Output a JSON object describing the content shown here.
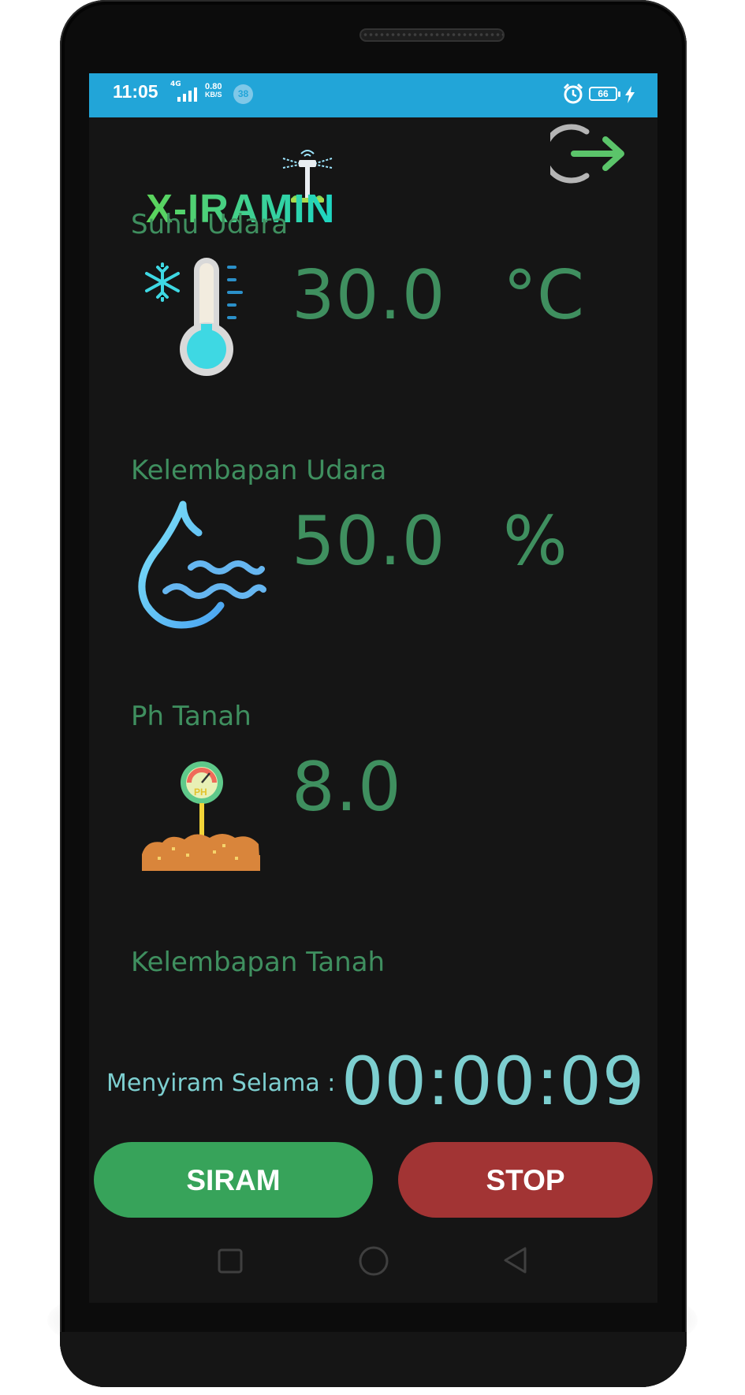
{
  "status_bar": {
    "time": "11:05",
    "network_type": "4G",
    "speed_value": "0.80",
    "speed_unit": "KB/S",
    "notification_count": "38",
    "battery": "66"
  },
  "header": {
    "logo_text": "X-IRAMIN",
    "logout_icon": "logout-arrow-icon"
  },
  "cards": [
    {
      "title": "Suhu Udara",
      "value": "30.0",
      "unit": "°C",
      "icon": "thermometer-snowflake-icon"
    },
    {
      "title": "Kelembapan Udara",
      "value": "50.0",
      "unit": "%",
      "icon": "water-drop-waves-icon"
    },
    {
      "title": "Ph Tanah",
      "value": "8.0",
      "unit": "",
      "icon": "ph-meter-soil-icon"
    },
    {
      "title": "Kelembapan Tanah",
      "value": "",
      "unit": "",
      "icon": ""
    }
  ],
  "timer": {
    "label": "Menyiram Selama :",
    "value": "00:00:09"
  },
  "buttons": {
    "siram": "SIRAM",
    "stop": "STOP"
  },
  "colors": {
    "status_bar": "#22a5d8",
    "screen_bg": "#151515",
    "value_text": "#3f8f5f",
    "timer_text": "#7dcfd0",
    "siram_button": "#37a35a",
    "stop_button": "#a23434"
  },
  "navigation": {
    "recents_icon": "square-recents-icon",
    "home_icon": "circle-home-icon",
    "back_icon": "triangle-back-icon"
  }
}
